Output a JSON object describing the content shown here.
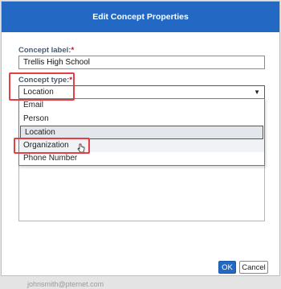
{
  "dialog": {
    "title": "Edit Concept Properties",
    "concept_label": {
      "label": "Concept label:",
      "required_mark": "*",
      "value": "Trellis High School"
    },
    "concept_type": {
      "label": "Concept type:",
      "required_mark": "*",
      "selected_value": "Location",
      "options": [
        "Email",
        "Person",
        "Location",
        "Organization",
        "Phone Number"
      ]
    },
    "buttons": {
      "ok": "OK",
      "cancel": "Cancel"
    }
  },
  "background": {
    "partial_email": "johnsmith@pternet.com"
  },
  "colors": {
    "titlebar": "#2369c3",
    "highlight": "#e43f44",
    "required": "#d0021b"
  }
}
